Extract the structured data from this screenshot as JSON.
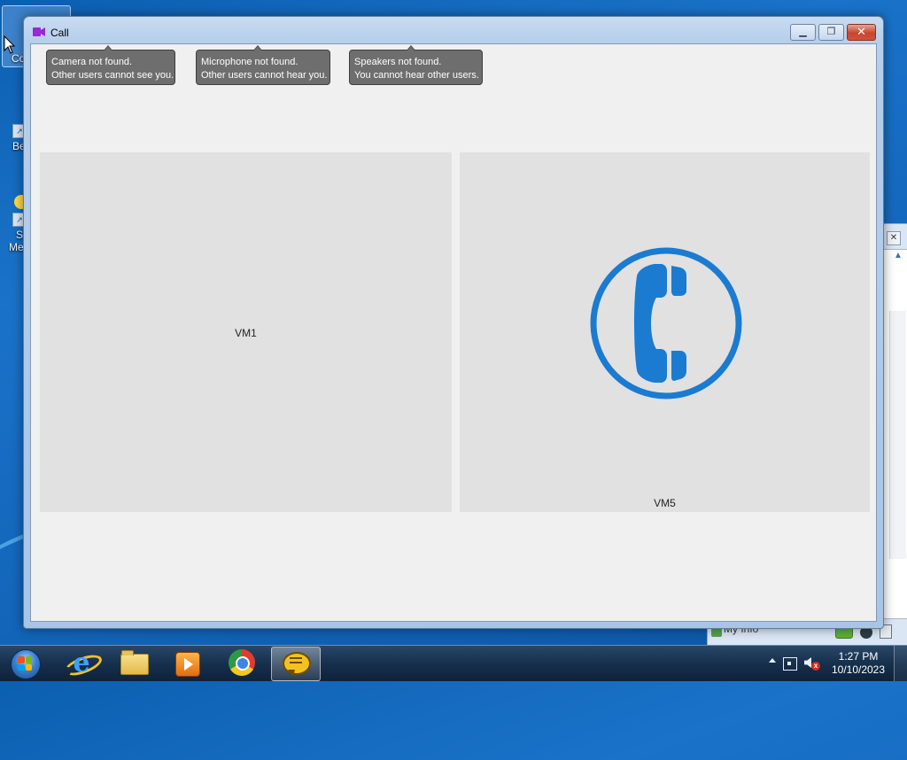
{
  "desktop": {
    "icons": [
      {
        "label": "Co"
      },
      {
        "label": "Be"
      },
      {
        "label": "S",
        "label2": "Me"
      }
    ]
  },
  "window": {
    "title": "Call",
    "buttons": {
      "minimize": "minimize-icon",
      "restore": "restore-icon",
      "close": "close-icon"
    }
  },
  "notifications": [
    {
      "line1": "Camera not found.",
      "line2": "Other users cannot see you."
    },
    {
      "line1": "Microphone not found.",
      "line2": "Other users cannot hear you."
    },
    {
      "line1": "Speakers not found.",
      "line2": "You cannot hear other users."
    }
  ],
  "participants": [
    {
      "name": "VM1"
    },
    {
      "name": "VM5",
      "icon": "phone-icon"
    }
  ],
  "background_window": {
    "status_label": "My Info"
  },
  "taskbar": {
    "pinned": [
      "internet-explorer-icon",
      "file-explorer-icon",
      "media-player-icon",
      "chrome-icon",
      "chat-app-icon"
    ],
    "clock": {
      "time": "1:27 PM",
      "date": "10/10/2023"
    }
  },
  "colors": {
    "phone_blue": "#1a7bd1",
    "pane_bg": "#e1e1e1",
    "tooltip_bg": "#6e6e6e"
  }
}
